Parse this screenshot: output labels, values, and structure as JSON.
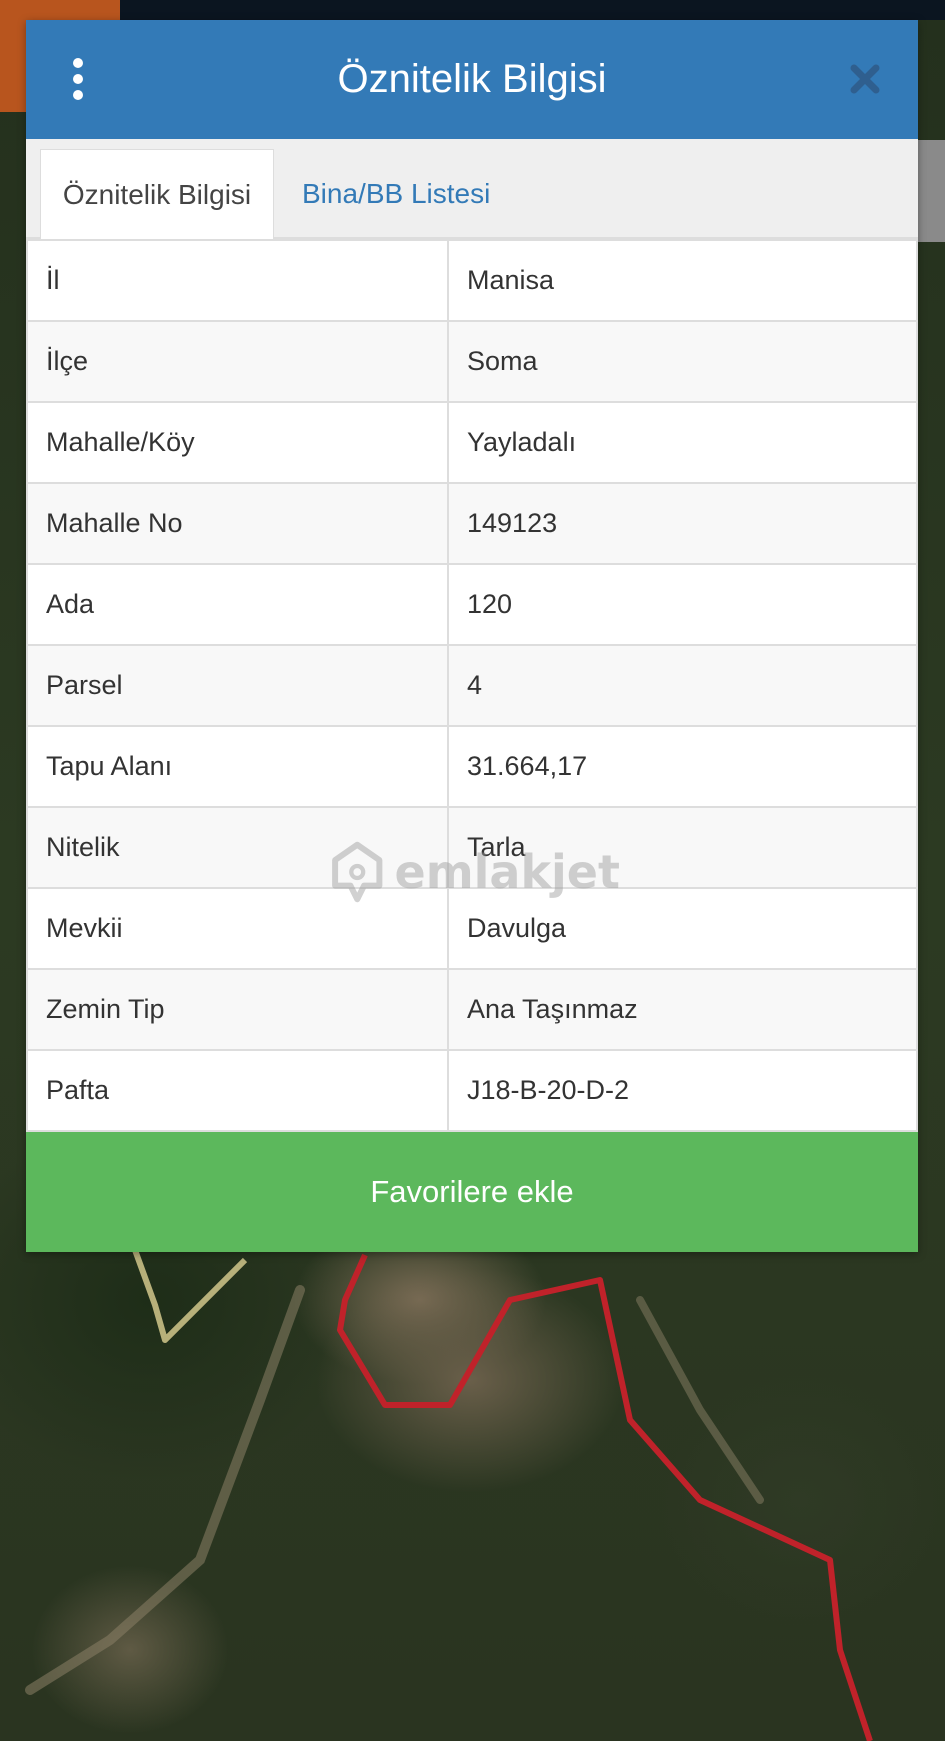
{
  "dialog": {
    "title": "Öznitelik Bilgisi",
    "menu_icon": "kebab-menu-icon",
    "close_icon": "close-icon"
  },
  "tabs": [
    {
      "label": "Öznitelik Bilgisi",
      "active": true
    },
    {
      "label": "Bina/BB Listesi",
      "active": false
    }
  ],
  "attributes": [
    {
      "key": "İl",
      "value": "Manisa"
    },
    {
      "key": "İlçe",
      "value": "Soma"
    },
    {
      "key": "Mahalle/Köy",
      "value": "Yayladalı"
    },
    {
      "key": "Mahalle No",
      "value": "149123"
    },
    {
      "key": "Ada",
      "value": "120"
    },
    {
      "key": "Parsel",
      "value": "4"
    },
    {
      "key": "Tapu Alanı",
      "value": "31.664,17"
    },
    {
      "key": "Nitelik",
      "value": "Tarla"
    },
    {
      "key": "Mevkii",
      "value": "Davulga"
    },
    {
      "key": "Zemin Tip",
      "value": "Ana Taşınmaz"
    },
    {
      "key": "Pafta",
      "value": "J18-B-20-D-2"
    }
  ],
  "actions": {
    "favorite_label": "Favorilere ekle"
  },
  "watermark": {
    "text": "emlakjet"
  },
  "colors": {
    "header": "#337ab7",
    "tab_link": "#337ab7",
    "favorite_button": "#5cb85c",
    "parcel_outline": "#c0222a",
    "neighbor_outline": "#b7b07a"
  }
}
